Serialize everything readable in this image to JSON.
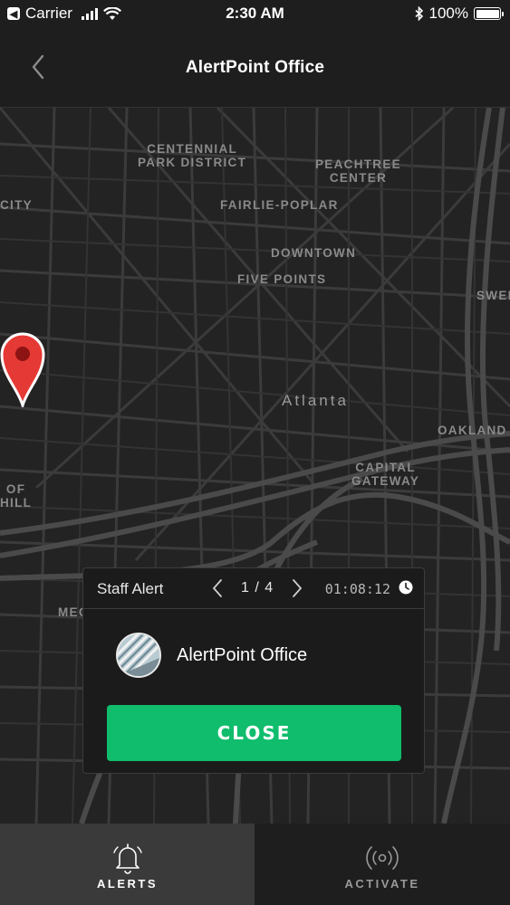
{
  "status_bar": {
    "carrier": "Carrier",
    "time": "2:30 AM",
    "battery": "100%"
  },
  "nav": {
    "title": "AlertPoint Office",
    "back_icon": "chevron-left-icon"
  },
  "map": {
    "labels": {
      "centennial": "CENTENNIAL\nPARK DISTRICT",
      "peachtree": "PEACHTREE\nCENTER",
      "city": "CITY",
      "fairlie": "FAIRLIE-POPLAR",
      "downtown": "DOWNTOWN",
      "five_points": "FIVE POINTS",
      "swee": "SWEE",
      "atlanta": "Atlanta",
      "oakland": "OAKLAND",
      "capital": "CAPITAL\nGATEWAY",
      "of_hill": "OF\nHILL",
      "mec": "MEC"
    },
    "pin_color": "#e53935"
  },
  "alert_card": {
    "type": "Staff Alert",
    "pager": "1 / 4",
    "time": "01:08:12",
    "organization": "AlertPoint Office",
    "close_label": "CLOSE",
    "close_color": "#0fbd6c"
  },
  "tabs": {
    "alerts": {
      "label": "ALERTS",
      "icon": "bell-icon"
    },
    "activate": {
      "label": "ACTIVATE",
      "icon": "broadcast-icon"
    }
  }
}
